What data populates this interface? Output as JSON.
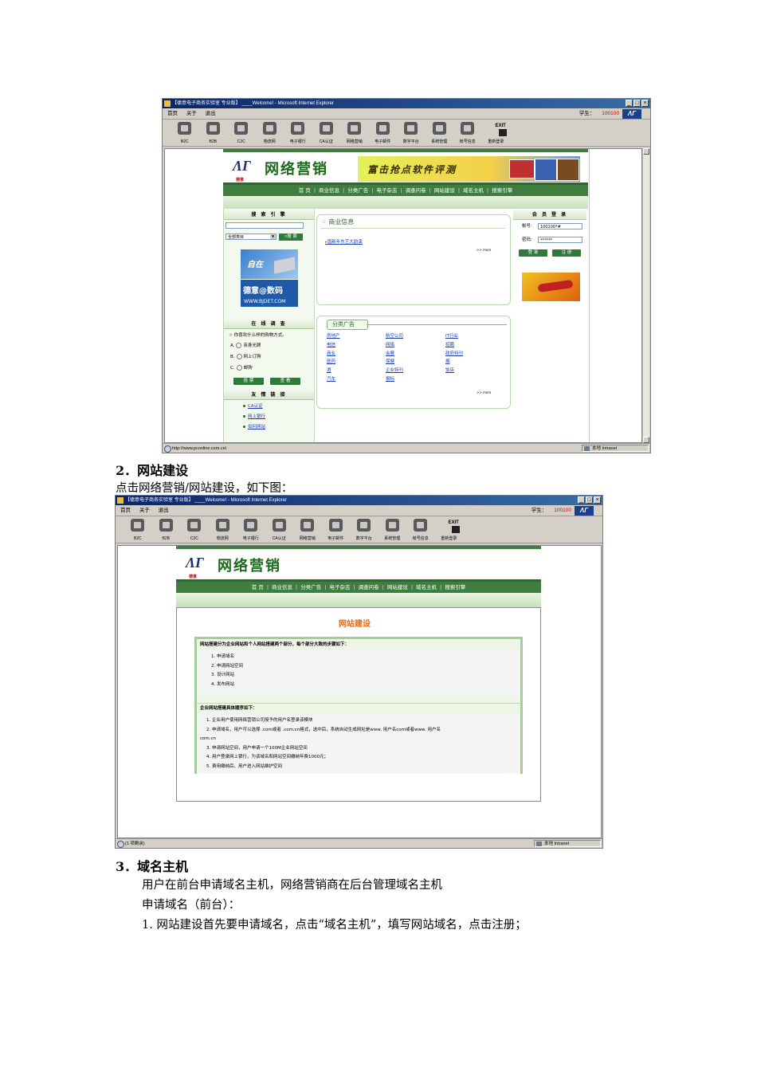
{
  "screenshot1": {
    "window_title": "【德意电子商务实验室 专业版】 ____Welcome! - Microsoft Internet Explorer",
    "menu": [
      "首页",
      "关于",
      "退出"
    ],
    "student_label": "学生：",
    "student_id": "100100",
    "toolbar": [
      {
        "label": "B2C",
        "icon": "b2c-icon"
      },
      {
        "label": "B2B",
        "icon": "b2b-icon"
      },
      {
        "label": "C2C",
        "icon": "c2c-icon"
      },
      {
        "label": "物流网",
        "icon": "logistics-icon"
      },
      {
        "label": "电子银行",
        "icon": "bank-icon"
      },
      {
        "label": "CA认证",
        "icon": "ca-certificate-icon"
      },
      {
        "label": "网络营销",
        "icon": "marketing-icon"
      },
      {
        "label": "电子邮件",
        "icon": "email-icon"
      },
      {
        "label": "数字平台",
        "icon": "digital-platform-icon"
      },
      {
        "label": "系统管理",
        "icon": "system-admin-icon"
      },
      {
        "label": "帐号信息",
        "icon": "account-info-icon"
      },
      {
        "label": "重新登录",
        "icon": "exit-icon",
        "exit_text": "EXIT"
      }
    ],
    "logo_small": "德意",
    "site_title": "网络营销",
    "banner_text": "富击抢点软件评测",
    "nav": [
      "首 页",
      "商业信息",
      "分类广告",
      "电子杂志",
      "调查问卷",
      "网站建设",
      "域名主机",
      "搜索引擎"
    ],
    "search_head": "搜 索 引 擎",
    "search_select": "全部类目",
    "search_button": "搜 索",
    "ad_text_1": "自在",
    "ad_text_2": "德意@数码",
    "ad_url": "WWW.BJDET.COM",
    "survey_head": "在 线 调 查",
    "survey_question": "你喜欢什么样的购物方式。",
    "survey_options": [
      {
        "letter": "A.",
        "text": "亲身光顾"
      },
      {
        "letter": "B.",
        "text": "网上订购"
      },
      {
        "letter": "C.",
        "text": "邮购"
      }
    ],
    "vote_button": "投 票",
    "view_button": "查 看",
    "links_head": "友 情 链 接",
    "links": [
      "CA认证",
      "网上银行",
      "如何网站"
    ],
    "business_title": "商业信息",
    "business_item": "国新年东艺大韵演",
    "more_label": ">> more",
    "classified_title": "分类广告",
    "classified_col1": [
      "房地产",
      "电信",
      "商业",
      "医药",
      "酒",
      "汽车"
    ],
    "classified_col2": [
      "航空公司",
      "网络",
      "会展",
      "保健",
      "企业特刊",
      "报标"
    ],
    "classified_col3": [
      "IT行业",
      "招聘",
      "政府特刊",
      "烟",
      "饭店"
    ],
    "member_head": "会 员 登 录",
    "account_label": "帐号:",
    "account_value": "100100*#",
    "password_label": "密码:",
    "password_value": "******",
    "login_button": "登 录",
    "register_button": "注 册",
    "status_url": "http://www.pconline.com.cn/",
    "status_zone": "本地 Intranet"
  },
  "section2": {
    "heading": "2．网站建设",
    "intro": "点击网络营销/网站建设，如下图："
  },
  "screenshot2": {
    "page_title": "网站建设",
    "box1_head": "网站搭建分为企业网站和个人网站搭建两个部分，每个部分大致的步骤如下：",
    "steps": [
      "1.  申请域名",
      "2.  申请网站空间",
      "3.  设计网站",
      "4.  发布网站"
    ],
    "box2_head": "企业网站搭建具体顺序如下：",
    "enterprise_steps": [
      "1.  企业用户使用网络营销公司授予的用户名登录该模块",
      "2.  申请域名，用户可以选择 .com或者 .com.cn格式，选中后，系统自动生成网址是www. 用户名com或者www. 用户名",
      "com.cn",
      "3.  申请网站空间，用户申请一个100M企业网站空间",
      "4.  用户登录网上银行，为该域名和网站空间缴纳年费1000元；",
      "5.  费用缴纳后，用户进入网站维护空间"
    ],
    "status_text": "(1 项剩余)",
    "status_zone": "本地 Intranet"
  },
  "section3": {
    "heading": "3．域名主机",
    "line1": "用户在前台申请域名主机，网络营销商在后台管理域名主机",
    "line2": "申请域名（前台）：",
    "line3": "1.  网站建设首先要申请域名，点击“域名主机”，填写网站域名，点击注册；"
  }
}
